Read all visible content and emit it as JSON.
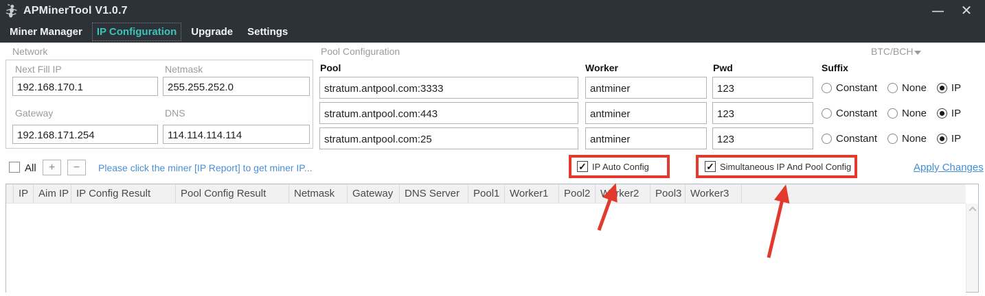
{
  "window": {
    "title": "APMinerTool V1.0.7",
    "minimize_glyph": "—",
    "close_glyph": "✕"
  },
  "menu": {
    "items": [
      {
        "label": "Miner Manager",
        "active": false
      },
      {
        "label": "IP Configuration",
        "active": true
      },
      {
        "label": "Upgrade",
        "active": false
      },
      {
        "label": "Settings",
        "active": false
      }
    ]
  },
  "network": {
    "section_label": "Network",
    "next_fill_ip": {
      "label": "Next Fill IP",
      "value": "192.168.170.1"
    },
    "netmask": {
      "label": "Netmask",
      "value": "255.255.252.0"
    },
    "gateway": {
      "label": "Gateway",
      "value": "192.168.171.254"
    },
    "dns": {
      "label": "DNS",
      "value": "114.114.114.114"
    }
  },
  "pool_config": {
    "section_label": "Pool Configuration",
    "coin_selector": "BTC/BCH",
    "headers": {
      "pool": "Pool",
      "worker": "Worker",
      "pwd": "Pwd",
      "suffix": "Suffix"
    },
    "suffix_options": [
      "Constant",
      "None",
      "IP"
    ],
    "rows": [
      {
        "pool": "stratum.antpool.com:3333",
        "worker": "antminer",
        "pwd": "123",
        "suffix_selected": "IP"
      },
      {
        "pool": "stratum.antpool.com:443",
        "worker": "antminer",
        "pwd": "123",
        "suffix_selected": "IP"
      },
      {
        "pool": "stratum.antpool.com:25",
        "worker": "antminer",
        "pwd": "123",
        "suffix_selected": "IP"
      }
    ]
  },
  "toolbar": {
    "all_label": "All",
    "plus_label": "+",
    "minus_label": "−",
    "hint": "Please click the miner [IP Report] to get miner IP...",
    "ip_auto_config": {
      "label": "IP Auto Config",
      "checked": true
    },
    "simultaneous_config": {
      "label": "Simultaneous IP And Pool Config",
      "checked": true
    },
    "apply_changes": "Apply Changes"
  },
  "miner_table": {
    "columns": [
      "IP",
      "Aim IP",
      "IP Config Result",
      "Pool Config Result",
      "Netmask",
      "Gateway",
      "DNS Server",
      "Pool1",
      "Worker1",
      "Pool2",
      "Worker2",
      "Pool3",
      "Worker3"
    ],
    "rows": []
  },
  "colors": {
    "titlebar_bg": "#2d3138",
    "accent_teal": "#3cc4ba",
    "link_blue": "#4a8fd3",
    "annotation_red": "#e23a2c"
  }
}
